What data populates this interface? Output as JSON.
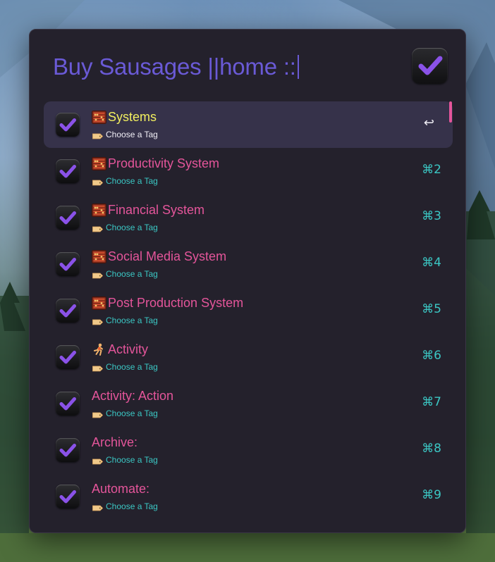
{
  "search": {
    "query": "Buy Sausages ||home ::"
  },
  "app_icon": "omnifocus-check-icon",
  "colors": {
    "query_text": "#6a5ad6",
    "selected_title": "#f2ef5f",
    "title": "#e4559a",
    "subtitle": "#3bc7c4",
    "panel_bg": "#24212c",
    "selected_bg": "#36324a",
    "checkmark": "#8a52e8"
  },
  "results": [
    {
      "title": "Systems",
      "emoji": "abacus",
      "subtitle": "Choose a Tag",
      "subtitle_icon": "tag-icon",
      "shortcut": "↩",
      "selected": true
    },
    {
      "title": "Productivity System",
      "emoji": "abacus",
      "subtitle": "Choose a Tag",
      "subtitle_icon": "tag-icon",
      "shortcut": "⌘2"
    },
    {
      "title": "Financial System",
      "emoji": "abacus",
      "subtitle": "Choose a Tag",
      "subtitle_icon": "tag-icon",
      "shortcut": "⌘3"
    },
    {
      "title": "Social Media System",
      "emoji": "abacus",
      "subtitle": "Choose a Tag",
      "subtitle_icon": "tag-icon",
      "shortcut": "⌘4"
    },
    {
      "title": "Post Production System",
      "emoji": "abacus",
      "subtitle": "Choose a Tag",
      "subtitle_icon": "tag-icon",
      "shortcut": "⌘5"
    },
    {
      "title": "Activity",
      "emoji": "runner",
      "subtitle": "Choose a Tag",
      "subtitle_icon": "tag-icon",
      "shortcut": "⌘6"
    },
    {
      "title": "Activity: Action",
      "emoji": "",
      "subtitle": "Choose a Tag",
      "subtitle_icon": "tag-icon",
      "shortcut": "⌘7"
    },
    {
      "title": "Archive:",
      "emoji": "",
      "subtitle": "Choose a Tag",
      "subtitle_icon": "tag-icon",
      "shortcut": "⌘8"
    },
    {
      "title": "Automate:",
      "emoji": "",
      "subtitle": "Choose a Tag",
      "subtitle_icon": "tag-icon",
      "shortcut": "⌘9"
    }
  ]
}
